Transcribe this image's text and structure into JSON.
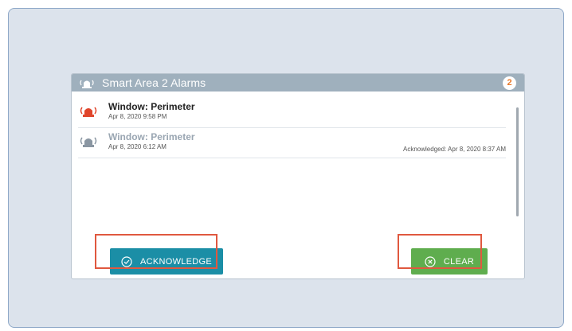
{
  "panel": {
    "title": "Smart Area 2 Alarms",
    "badge_count": "2",
    "header_icon": "alarm-siren-icon"
  },
  "alarms": [
    {
      "title": "Window: Perimeter",
      "time": "Apr 8, 2020 9:58 PM",
      "state": "active",
      "icon_color": "#e0452b",
      "acknowledged_text": ""
    },
    {
      "title": "Window: Perimeter",
      "time": "Apr 8, 2020 6:12 AM",
      "state": "acknowledged",
      "icon_color": "#8a96a2",
      "acknowledged_text": "Acknowledged: Apr 8, 2020 8:37 AM"
    }
  ],
  "actions": {
    "acknowledge_label": "ACKNOWLEDGE",
    "acknowledge_icon": "check-circle-icon",
    "clear_label": "CLEAR",
    "clear_icon": "x-circle-icon"
  },
  "colors": {
    "acknowledge_button": "#1b8ea6",
    "clear_button": "#5fad4e",
    "highlight": "#e0583f",
    "badge_text": "#e8792a"
  }
}
